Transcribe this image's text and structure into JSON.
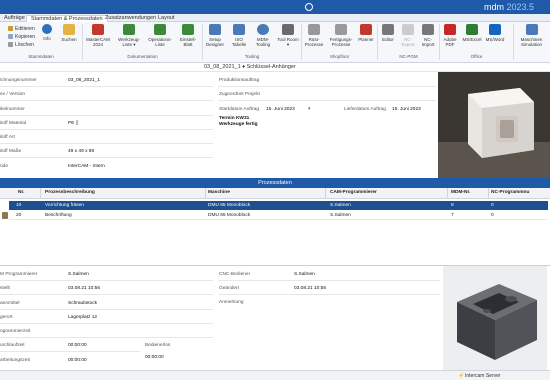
{
  "app": {
    "name": "mdm",
    "version": "2023.5"
  },
  "tabs": [
    {
      "label": "Aufträge"
    },
    {
      "label": "Stammdaten & Prozessdaten"
    },
    {
      "label": "Zusatzanwendungen"
    },
    {
      "label": "Layout"
    }
  ],
  "ribbon": {
    "small": {
      "edit": "Editieren",
      "copy": "Kopieren",
      "delete": "Löschen"
    },
    "buttons": {
      "info": "Info",
      "search": "Suchen",
      "mastercam": "MasterCAM 2024",
      "tool_list": "Werkzeug-Liste ▾",
      "op_list": "Operations-Liste",
      "setup_sheet": "Einstell-Blatt",
      "setup_designer": "Setup Designer",
      "iso_table": "ISO Tabelle",
      "mdm_tooling": "MDM-Tooling",
      "tool_room": "Tool Room ▾",
      "ruest": "Rüst-Prozesse",
      "fertigung": "Fertigungs-Prozesse",
      "planner": "Planner",
      "editor": "Editor",
      "nc_export": "NC-Export",
      "nc_import": "NC-Import",
      "adobe_pdf": "Adobe PDF",
      "ms_excel": "MS/Excel",
      "ms_word": "MS/Word",
      "machine_sim": "Maschinen Simulation"
    },
    "groups": {
      "stammdaten": "Stammdaten",
      "dokumentation": "Dokumentation",
      "tooling": "Tooling",
      "shopfloor": "Shopfloor",
      "nc_pgm": "NC-PGM",
      "office": "Office"
    }
  },
  "breadcrumb": "03_08_2021_1 ♦ Schlüssel-Anhänger",
  "form": {
    "zeichnungsnummer_label": "ichnungsnummer",
    "zeichnungsnummer_value": "03_08_2021_1",
    "index_label": "ex / Version",
    "artikelnummer_label": "ikelnummer",
    "material_label": "itoff Material",
    "material_value": "PE ▯",
    "art_label": "itoff Art",
    "masse_label": "itoff Maße",
    "masse_value": "49 x 49 x 88",
    "kunde_label": "nde",
    "kunde_value": "InterCAM - Intern",
    "produktionsauftrag_label": "Produktionsauftrag",
    "projekt_label": "Zugeordnet Projekt",
    "startdatum_label": "Startdatum Auftrag",
    "startdatum_value": "15. Juni 2023",
    "liefer_label": "Lieferdatum Auftrag",
    "liefer_value": "15. Juni 2023",
    "note_line1": "Termin KW31",
    "note_line2": "Werkzeuge fertig"
  },
  "process": {
    "title": "Prozessdaten",
    "columns": {
      "nr": "Nr.",
      "beschreibung": "Prozessbeschreibung",
      "maschine": "Maschine",
      "cam": "CAM-Programmierer",
      "mdm_nr": "MDM-Nr.",
      "nc_programm": "NC-Programmnu"
    },
    "rows": [
      {
        "nr": "10",
        "beschreibung": "Vorrichtung fräsen",
        "maschine": "DMU 65 Monoblock",
        "cam": "S.Salmen",
        "mdm_nr": "8",
        "nc_programm": "0"
      },
      {
        "nr": "20",
        "beschreibung": "Beschriftung",
        "maschine": "DMU 65 Monoblock",
        "cam": "S.Salmen",
        "mdm_nr": "7",
        "nc_programm": "0"
      }
    ]
  },
  "details": {
    "programmierer_label": "M Programmierer",
    "programmierer_value": "S.Salmen",
    "erstellt_label": "stellt",
    "erstellt_value": "03.08.21 10:56",
    "spannmittel_label": "annmittel",
    "spannmittel_value": "Schraubstock",
    "lagerort_label": "gerort",
    "lagerort_value": "Lagerplatz 12",
    "programmierzeit_label": "ogrammierzeit",
    "durchlaufzeit_label": "urchlaufzeit",
    "durchlaufzeit_value": "00:00:00",
    "bedienerlos_label": "Bedienerlos",
    "bedienerlos_value": "00:00:00",
    "bearbeitungszeit_label": "arbeitungszeit",
    "bearbeitungszeit_value": "00:00:00",
    "cnc_label": "CNC-Bediener",
    "cnc_value": "S.Salmen",
    "geaendert_label": "Geändert",
    "geaendert_value": "03.08.21 10:56",
    "anmerkung_label": "Anmerkung"
  },
  "status": {
    "server": "Intercam Server"
  },
  "colors": {
    "accent": "#1e5aa8",
    "selection": "#1e4f8f"
  }
}
